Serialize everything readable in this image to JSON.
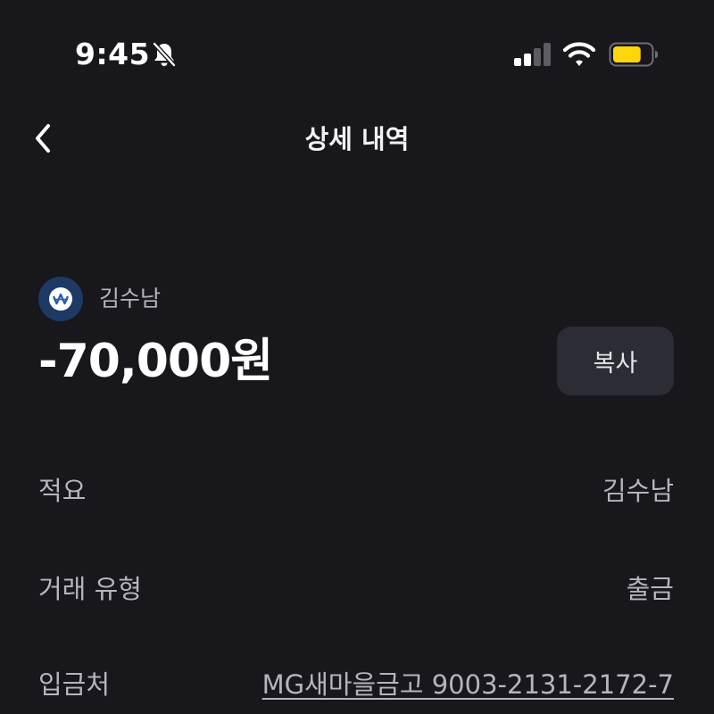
{
  "status_bar": {
    "time": "9:45",
    "mute_icon": "bell-slash-icon",
    "signal_icon": "cellular-signal-icon",
    "wifi_icon": "wifi-icon",
    "battery_icon": "battery-icon",
    "battery_level": 0.75,
    "battery_color": "#ffd60a"
  },
  "nav": {
    "back_icon": "chevron-left-icon",
    "title": "상세 내역"
  },
  "transaction": {
    "bank_logo_icon": "bank-logo-icon",
    "counterparty": "김수남",
    "amount": "-70,000원",
    "copy_label": "복사"
  },
  "details": [
    {
      "label": "적요",
      "value": "김수남"
    },
    {
      "label": "거래 유형",
      "value": "출금"
    },
    {
      "label": "입금처",
      "value": "MG새마을금고 9003-2131-2172-7"
    }
  ],
  "colors": {
    "background": "#17171c",
    "button_bg": "#2c2c35",
    "secondary_text": "#b5b5bd",
    "bank_logo_bg": "#1e3a64"
  }
}
